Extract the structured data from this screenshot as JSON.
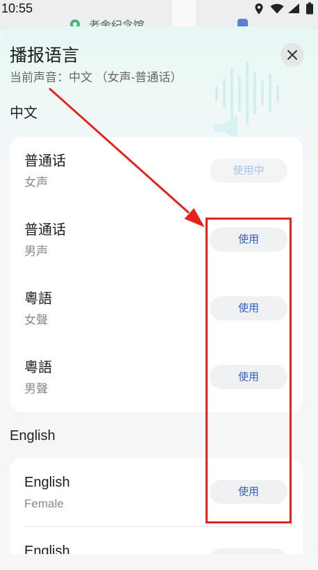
{
  "status_bar": {
    "time": "10:55",
    "icons": [
      "location-icon",
      "wifi-icon",
      "signal-icon",
      "battery-icon"
    ]
  },
  "map": {
    "poi_label": "老舍纪念馆",
    "poi_icon": "park-marker-icon",
    "hotel_icon": "hotel-marker-icon"
  },
  "sheet": {
    "title": "播报语言",
    "current_voice": "当前声音：中文 （女声-普通话）",
    "close_icon": "close-icon",
    "decoration_icon": "soundwave-icon"
  },
  "sections": [
    {
      "label": "中文",
      "items": [
        {
          "name": "普通话",
          "voice": "女声",
          "button": "使用中",
          "in_use": true
        },
        {
          "name": "普通话",
          "voice": "男声",
          "button": "使用",
          "in_use": false
        },
        {
          "name": "粵語",
          "voice": "女聲",
          "button": "使用",
          "in_use": false
        },
        {
          "name": "粵語",
          "voice": "男聲",
          "button": "使用",
          "in_use": false
        }
      ]
    },
    {
      "label": "English",
      "items": [
        {
          "name": "English",
          "voice": "Female",
          "button": "使用",
          "in_use": false
        },
        {
          "name": "English",
          "in_use": false
        }
      ]
    }
  ],
  "colors": {
    "accent": "#2e5fc8",
    "accent_disabled": "#a8c3ee",
    "button_bg": "#f0f1f3",
    "sheet_top": "#e6f7f4",
    "sheet_bg": "#f4f6f8",
    "card_bg": "#ffffff",
    "annotation": "#e3231c"
  }
}
